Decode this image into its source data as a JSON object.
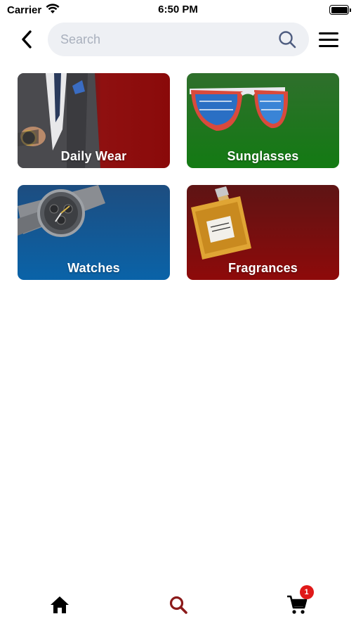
{
  "status_bar": {
    "carrier": "Carrier",
    "time": "6:50 PM",
    "icons": [
      "wifi-icon",
      "battery-icon"
    ]
  },
  "header": {
    "back_icon": "chevron-left-icon",
    "search": {
      "placeholder": "Search",
      "value": "",
      "icon": "search-icon"
    },
    "menu_icon": "hamburger-menu-icon"
  },
  "categories": [
    {
      "label": "Daily Wear"
    },
    {
      "label": "Sunglasses"
    },
    {
      "label": "Watches"
    },
    {
      "label": "Fragrances"
    }
  ],
  "tab_bar": {
    "items": [
      {
        "icon": "home-icon",
        "active": false
      },
      {
        "icon": "search-icon",
        "active": true
      },
      {
        "icon": "cart-icon",
        "active": false,
        "badge": "1"
      }
    ],
    "active_color": "#8b1a1a",
    "badge_color": "#e01919"
  }
}
